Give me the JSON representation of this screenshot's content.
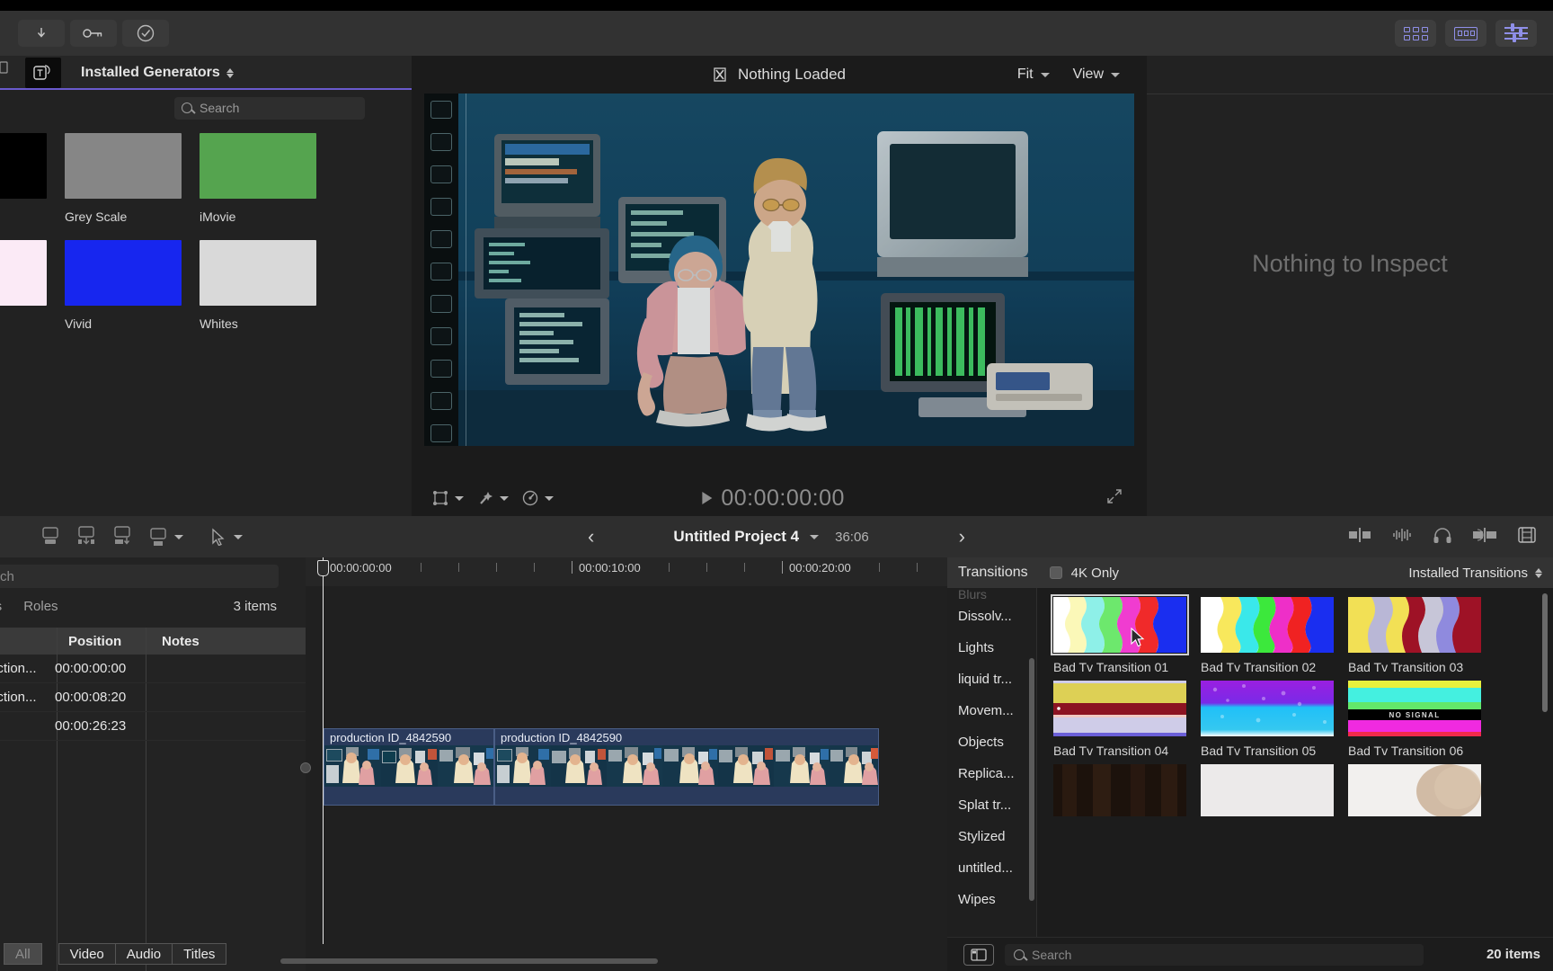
{
  "toolbar": {
    "left_buttons": [
      {
        "name": "import-media-button",
        "icon": "download-arrow-icon"
      },
      {
        "name": "keyword-button",
        "icon": "key-icon"
      },
      {
        "name": "analysis-button",
        "icon": "check-circle-icon"
      }
    ],
    "right_buttons": [
      {
        "name": "browser-toggle-button",
        "icon": "grid-icon"
      },
      {
        "name": "effects-browser-button",
        "icon": "filmstrip-icon"
      },
      {
        "name": "inspector-toggle-button",
        "icon": "sliders-icon"
      }
    ],
    "accent_color": "#8f8fe8"
  },
  "browser": {
    "tab_icon": "titles-generators-icon",
    "title": "Installed Generators",
    "search_placeholder": "Search",
    "underline_color": "#6a5acd",
    "generators": [
      {
        "label": "",
        "color": "#000000",
        "partial": true
      },
      {
        "label": "Grey Scale",
        "color": "#868686"
      },
      {
        "label": "iMovie",
        "color": "#55a44f"
      },
      {
        "label": "",
        "color": "#fbeaf6",
        "partial": true
      },
      {
        "label": "Vivid",
        "color": "#1726ef"
      },
      {
        "label": "Whites",
        "color": "#d9d9d9"
      }
    ]
  },
  "viewer": {
    "status_icon": "hourglass-icon",
    "status_text": "Nothing Loaded",
    "zoom_menu": "Fit",
    "view_menu": "View",
    "timecode": "00:00:00:00",
    "bottom_tools": [
      {
        "name": "transform-tool",
        "icon": "transform-icon"
      },
      {
        "name": "enhancements-tool",
        "icon": "magic-wand-icon"
      },
      {
        "name": "retime-tool",
        "icon": "speedometer-icon"
      }
    ],
    "expand_icon": "expand-arrows-icon"
  },
  "inspector": {
    "empty_text": "Nothing to Inspect"
  },
  "project_bar": {
    "left_tools": [
      {
        "name": "append-button",
        "icon": "append-icon"
      },
      {
        "name": "insert-button",
        "icon": "insert-icon"
      },
      {
        "name": "connect-button",
        "icon": "connect-icon"
      },
      {
        "name": "overwrite-button",
        "icon": "overwrite-icon"
      },
      {
        "name": "tool-select-button",
        "icon": "arrow-tool-icon"
      }
    ],
    "prev_label": "‹",
    "title": "Untitled Project 4",
    "duration": "36:06",
    "next_label": "›",
    "right_tools": [
      {
        "name": "audio-meter-button",
        "icon": "audio-level-icon"
      },
      {
        "name": "waveform-button",
        "icon": "waveform-icon"
      },
      {
        "name": "headphones-button",
        "icon": "headphones-icon"
      },
      {
        "name": "audio-pan-button",
        "icon": "pan-icon"
      },
      {
        "name": "timeline-index-button",
        "icon": "filmstrip-frame-icon"
      }
    ]
  },
  "timeline_index": {
    "search_value": "ch",
    "tabs": [
      "ags",
      "Roles"
    ],
    "count_label": "3 items",
    "columns": [
      "",
      "Position",
      "Notes"
    ],
    "rows": [
      {
        "name": "uction...",
        "position": "00:00:00:00",
        "notes": ""
      },
      {
        "name": "uction...",
        "position": "00:00:08:20",
        "notes": ""
      },
      {
        "name": "",
        "position": "00:00:26:23",
        "notes": ""
      }
    ],
    "filters": [
      {
        "label": "All",
        "selected": true
      },
      {
        "label": "Video",
        "selected": false
      },
      {
        "label": "Audio",
        "selected": false
      },
      {
        "label": "Titles",
        "selected": false
      }
    ]
  },
  "timeline": {
    "ruler_labels": [
      "00:00:00:00",
      "00:00:10:00",
      "00:00:20:00"
    ],
    "clips": [
      {
        "name": "production ID_4842590"
      },
      {
        "name": "production ID_4842590"
      }
    ]
  },
  "transitions": {
    "panel_title": "Transitions",
    "filter_label": "4K Only",
    "filter_checked": false,
    "installed_label": "Installed Transitions",
    "categories": [
      {
        "label": "Blurs",
        "clipped": true
      },
      {
        "label": "Dissolv..."
      },
      {
        "label": "Lights"
      },
      {
        "label": "liquid tr..."
      },
      {
        "label": "Movem..."
      },
      {
        "label": "Objects"
      },
      {
        "label": "Replica..."
      },
      {
        "label": "Splat tr..."
      },
      {
        "label": "Stylized"
      },
      {
        "label": "untitled..."
      },
      {
        "label": "Wipes"
      }
    ],
    "items": [
      {
        "label": "Bad Tv Transition 01",
        "selected": true,
        "style": "rainbow-vertical"
      },
      {
        "label": "Bad Tv Transition 02",
        "selected": false,
        "style": "rainbow-vertical-2"
      },
      {
        "label": "Bad Tv Transition 03",
        "selected": false,
        "style": "yellow-purple-bands"
      },
      {
        "label": "Bad Tv Transition 04",
        "selected": false,
        "style": "horizontal-bands"
      },
      {
        "label": "Bad Tv Transition 05",
        "selected": false,
        "style": "purple-cyan-noise"
      },
      {
        "label": "Bad Tv Transition 06",
        "selected": false,
        "style": "no-signal"
      },
      {
        "label": "",
        "selected": false,
        "style": "dark"
      },
      {
        "label": "",
        "selected": false,
        "style": "white"
      },
      {
        "label": "",
        "selected": false,
        "style": "blurred-portrait"
      }
    ],
    "search_placeholder": "Search",
    "count_label": "20 items",
    "sidebar_button_icon": "sidebar-toggle-icon"
  }
}
